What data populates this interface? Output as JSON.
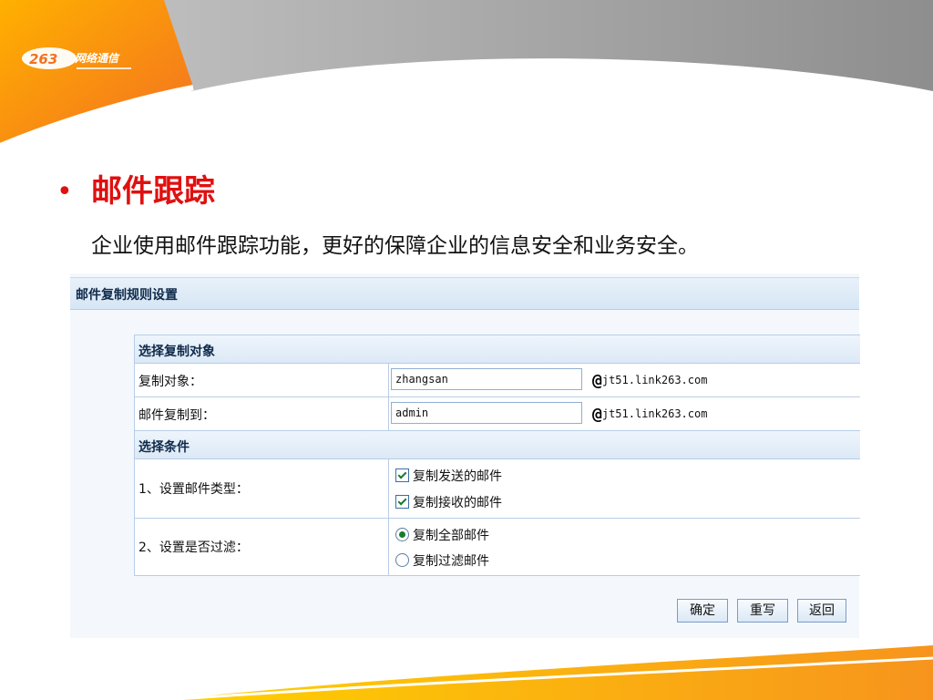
{
  "logo": {
    "name": "263-logo",
    "brand_text": "263网络通信"
  },
  "slide": {
    "bullet_char": "•",
    "title": "邮件跟踪",
    "description": "企业使用邮件跟踪功能，更好的保障企业的信息安全和业务安全。"
  },
  "panel": {
    "title": "邮件复制规则设置",
    "section_target": "选择复制对象",
    "copy_target_label": "复制对象：",
    "copy_target_value": "zhangsan",
    "copy_to_label": "邮件复制到：",
    "copy_to_value": "admin",
    "at_sign": "@",
    "domain": "jt51.link263.com",
    "section_conditions": "选择条件",
    "mail_type_label": "1、设置邮件类型：",
    "mail_type_options": [
      "复制发送的邮件",
      "复制接收的邮件"
    ],
    "filter_label": "2、设置是否过滤：",
    "filter_options": [
      "复制全部邮件",
      "复制过滤邮件"
    ],
    "buttons": {
      "confirm": "确定",
      "rewrite": "重写",
      "back": "返回"
    }
  },
  "colors": {
    "accent_red": "#e01010",
    "orange": "#f7941d",
    "panel_blue": "#d6e6f5"
  }
}
